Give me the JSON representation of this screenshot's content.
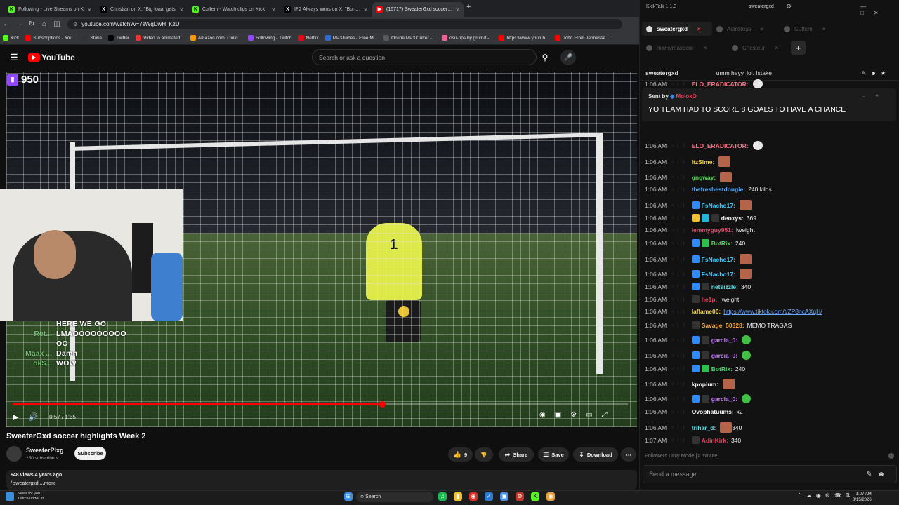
{
  "browser": {
    "tabs": [
      {
        "label": "Following - Live Streams on Ki",
        "icon": "kick-icon",
        "active": false
      },
      {
        "label": "Christian on X: \"Big loaaf gets",
        "icon": "x-icon",
        "active": false
      },
      {
        "label": "Cuffem - Watch clips on Kick",
        "icon": "kick-icon",
        "active": false
      },
      {
        "label": "IP2 Always Wins on X: \"Burt Bro",
        "icon": "x-icon",
        "active": false
      },
      {
        "label": "(15717) SweaterGxd soccer hig",
        "icon": "youtube-icon",
        "active": true
      }
    ],
    "url": "youtube.com/watch?v=7sWqDwH_KzU",
    "bookmarks": [
      "Kick",
      "Subscriptions - You...",
      "Stake",
      "Twitter",
      "Video to animated...",
      "Amazon.com: Onlin...",
      "Following - Twitch",
      "Netflix",
      "MP3Juices - Free M...",
      "Online MP3 Cutter -...",
      "osu-pps by grumd -...",
      "https://www.youtub...",
      "John From Tennesse..."
    ]
  },
  "youtube": {
    "logo_text": "YouTube",
    "search_placeholder": "Search or ask a question",
    "video": {
      "viewer_count": "950",
      "time": "0:57 / 1:35",
      "progress": 0.6,
      "overlay_chat": [
        {
          "name": "",
          "msg": "HERE WE GO"
        },
        {
          "name": "Ret...",
          "msg": "LMAOOOOOOOOO"
        },
        {
          "name": "",
          "msg": "OO"
        },
        {
          "name": "Maax ...",
          "msg": "Damn"
        },
        {
          "name": "ok$...",
          "msg": "WOW"
        }
      ]
    },
    "title": "SweaterGxd soccer highlights Week 2",
    "channel": {
      "name": "SweaterPlxg",
      "subscribers": "250 subscribers",
      "subscribe_label": "Subscribe"
    },
    "actions": {
      "likes": "9",
      "share": "Share",
      "save": "Save",
      "download": "Download"
    },
    "description": {
      "meta": "648 views  4 years ago",
      "line": "/ sweatergxd",
      "more": "...more"
    }
  },
  "taskbar": {
    "news_title": "News for you",
    "news_sub": "Twitch under fir...",
    "search": "Search",
    "time": "1:07 AM",
    "date": "8/15/2026"
  },
  "kicktalk": {
    "app_title": "KickTalk 1.1.3",
    "user": "sweatergxd",
    "tabs": [
      {
        "label": "sweatergxd",
        "active": true
      },
      {
        "label": "AdinRoss",
        "active": false
      },
      {
        "label": "Cuffem",
        "active": false
      },
      {
        "label": "markymaxdoor",
        "active": false
      },
      {
        "label": "Chesteur",
        "active": false
      }
    ],
    "chat_header": {
      "channel": "sweatergxd",
      "title": "umm heyy. lol. !stake"
    },
    "pinned": {
      "sent_by_label": "Sent by",
      "sender": "MoloxO",
      "message": "YO TEAM HAD TO SCORE 8 GOALS TO HAVE A CHANCE"
    },
    "messages": [
      {
        "time": "1:06 AM",
        "user": "ELO_ERADICATOR:",
        "color": "#ff6f86",
        "text": "",
        "emote": "white",
        "badges": []
      },
      {
        "time": "1:06 AM",
        "user": "ELO_ERADICATOR:",
        "color": "#ff6f86",
        "text": "",
        "emote": "white",
        "badges": []
      },
      {
        "time": "1:06 AM",
        "user": "ItzSime:",
        "color": "#f2d34a",
        "text": "",
        "emote": "face",
        "badges": []
      },
      {
        "time": "1:06 AM",
        "user": "gngway:",
        "color": "#53d85a",
        "text": "",
        "emote": "face",
        "badges": []
      },
      {
        "time": "1:06 AM",
        "user": "thefreshestdougie:",
        "color": "#4aa8ff",
        "text": "240 kilos",
        "emote": "",
        "badges": []
      },
      {
        "time": "1:06 AM",
        "user": "FsNacho17:",
        "color": "#39c7ff",
        "text": "",
        "emote": "face",
        "badges": [
          "#2e8bff"
        ]
      },
      {
        "time": "1:06 AM",
        "user": "deoxys:",
        "color": "#f1f1f1",
        "text": "369",
        "emote": "",
        "badges": [
          "#f2c230",
          "#20b7d8",
          "#333"
        ]
      },
      {
        "time": "1:06 AM",
        "user": "lemmyguy951:",
        "color": "#d94c6c",
        "text": "!weight",
        "emote": "",
        "badges": []
      },
      {
        "time": "1:06 AM",
        "user": "BotRix:",
        "color": "#4ed86a",
        "text": "240",
        "emote": "",
        "badges": [
          "#2e8bff",
          "#28c24a"
        ]
      },
      {
        "time": "1:06 AM",
        "user": "FsNacho17:",
        "color": "#39c7ff",
        "text": "",
        "emote": "face",
        "badges": [
          "#2e8bff"
        ]
      },
      {
        "time": "1:06 AM",
        "user": "FsNacho17:",
        "color": "#39c7ff",
        "text": "",
        "emote": "face",
        "badges": [
          "#2e8bff"
        ]
      },
      {
        "time": "1:06 AM",
        "user": "netsizzle:",
        "color": "#5ee0e6",
        "text": "340",
        "emote": "",
        "badges": [
          "#2e8bff",
          "#333"
        ]
      },
      {
        "time": "1:06 AM",
        "user": "he1p:",
        "color": "#e0415b",
        "text": "!weight",
        "emote": "",
        "badges": [
          "#333"
        ]
      },
      {
        "time": "1:06 AM",
        "user": "laflame00:",
        "color": "#f2d34a",
        "text": "https://www.tiktok.com/t/ZP8ncAXqH/",
        "emote": "",
        "badges": [],
        "link": true
      },
      {
        "time": "1:06 AM",
        "user": "Savage_50328:",
        "color": "#f2a83a",
        "text": "MEMO TRAGAS",
        "emote": "",
        "badges": [
          "#333"
        ]
      },
      {
        "time": "1:06 AM",
        "user": "garcia_0:",
        "color": "#c77cff",
        "text": "",
        "emote": "green",
        "badges": [
          "#2e8bff",
          "#333"
        ]
      },
      {
        "time": "1:06 AM",
        "user": "garcia_0:",
        "color": "#c77cff",
        "text": "",
        "emote": "green",
        "badges": [
          "#2e8bff",
          "#333"
        ]
      },
      {
        "time": "1:06 AM",
        "user": "BotRix:",
        "color": "#4ed86a",
        "text": "240",
        "emote": "",
        "badges": [
          "#2e8bff",
          "#28c24a"
        ]
      },
      {
        "time": "1:06 AM",
        "user": "kpopium:",
        "color": "#f1f1f1",
        "text": "",
        "emote": "face",
        "badges": []
      },
      {
        "time": "1:06 AM",
        "user": "garcia_0:",
        "color": "#c77cff",
        "text": "",
        "emote": "green",
        "badges": [
          "#2e8bff",
          "#333"
        ]
      },
      {
        "time": "1:06 AM",
        "user": "Ovophatuums:",
        "color": "#f1f1f1",
        "text": "x2",
        "emote": "",
        "badges": []
      },
      {
        "time": "1:06 AM",
        "user": "trihar_d:",
        "color": "#5ee0e6",
        "text": "340",
        "emote": "face",
        "badges": []
      },
      {
        "time": "1:07 AM",
        "user": "AdinKirk:",
        "color": "#e0415b",
        "text": "340",
        "emote": "",
        "badges": [
          "#333"
        ]
      }
    ],
    "followers_mode": "Followers Only Mode [1 minute]",
    "send_placeholder": "Send a message..."
  }
}
